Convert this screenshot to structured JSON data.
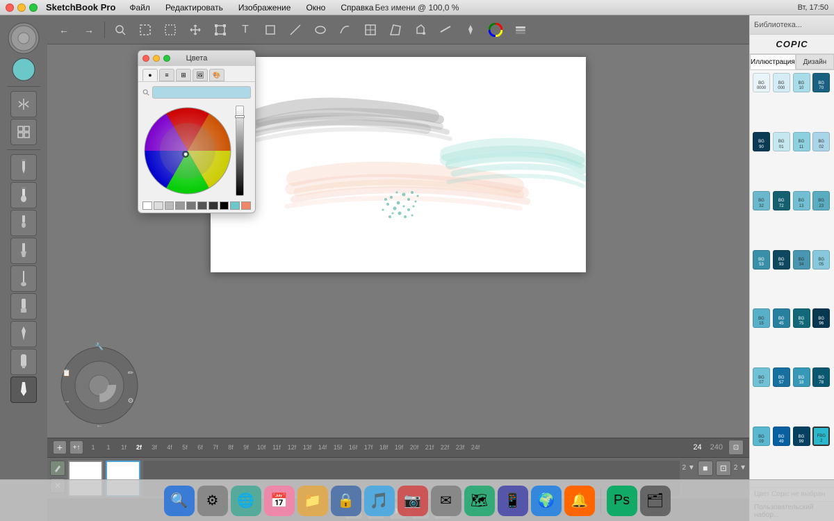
{
  "menubar": {
    "app_name": "SketchBook Pro",
    "title": "Без имени @ 100,0 %",
    "menus": [
      "Файл",
      "Редактировать",
      "Изображение",
      "Окно",
      "Справка"
    ],
    "time": "Вт, 17:50"
  },
  "toolbar": {
    "undo_label": "←",
    "redo_label": "→"
  },
  "color_dialog": {
    "title": "Цвета",
    "search_placeholder": ""
  },
  "right_panel": {
    "header": "Библиотека...",
    "logo": "COPIC",
    "tabs": [
      "Иллюстрация",
      "Дизайн"
    ],
    "no_color": "Цвет Copic не выбран",
    "custom_set": "Пользовательский набор..."
  },
  "timeline": {
    "frame_numbers": [
      "1",
      "1",
      "1f",
      "2f",
      "3f",
      "4f",
      "5f",
      "6f",
      "7f",
      "8f",
      "9f",
      "10f",
      "11f",
      "12f",
      "13f",
      "14f",
      "15f",
      "16f",
      "17f",
      "18f",
      "19f",
      "20f",
      "21f",
      "22f",
      "23f",
      "24f"
    ],
    "end_frame": "240",
    "current": "24"
  },
  "copic_colors": [
    {
      "code": "BG\n0000",
      "color": "#e8f4f8"
    },
    {
      "code": "BG\n000",
      "color": "#d4ecf4"
    },
    {
      "code": "BG\n10",
      "color": "#a8dce8"
    },
    {
      "code": "BG\n70",
      "color": "#1a6080"
    },
    {
      "code": "BG\n90",
      "color": "#0a3a54"
    },
    {
      "code": "BG\n01",
      "color": "#c5e8f0"
    },
    {
      "code": "BG\n11",
      "color": "#8dd0e0"
    },
    {
      "code": "BG\n02",
      "color": "#aad4e8"
    },
    {
      "code": "BG\n32",
      "color": "#6bb8cc"
    },
    {
      "code": "BG\n72",
      "color": "#156070"
    },
    {
      "code": "BG\n13",
      "color": "#72bfd4"
    },
    {
      "code": "BG\n23",
      "color": "#5aacc0"
    },
    {
      "code": "BG\n53",
      "color": "#3a8fa8"
    },
    {
      "code": "BG\n93",
      "color": "#0e4860"
    },
    {
      "code": "BG\n34",
      "color": "#4896b0"
    },
    {
      "code": "BG\n05",
      "color": "#88c8dc"
    },
    {
      "code": "BG\n15",
      "color": "#58b0c8"
    },
    {
      "code": "BG\n45",
      "color": "#2880a0"
    },
    {
      "code": "BG\n75",
      "color": "#106878"
    },
    {
      "code": "BG\n96",
      "color": "#083850"
    },
    {
      "code": "BG\n07",
      "color": "#70c0d8"
    },
    {
      "code": "BG\n57",
      "color": "#1870a0"
    },
    {
      "code": "BG\n18",
      "color": "#3898b8"
    },
    {
      "code": "BG\n78",
      "color": "#0a5870"
    },
    {
      "code": "BG\n09",
      "color": "#58b8d0"
    },
    {
      "code": "BG\n49",
      "color": "#0860a0"
    },
    {
      "code": "BG\n99",
      "color": "#064060"
    },
    {
      "code": "FBG\n2",
      "color": "#2ab8cc",
      "selected": true
    }
  ]
}
